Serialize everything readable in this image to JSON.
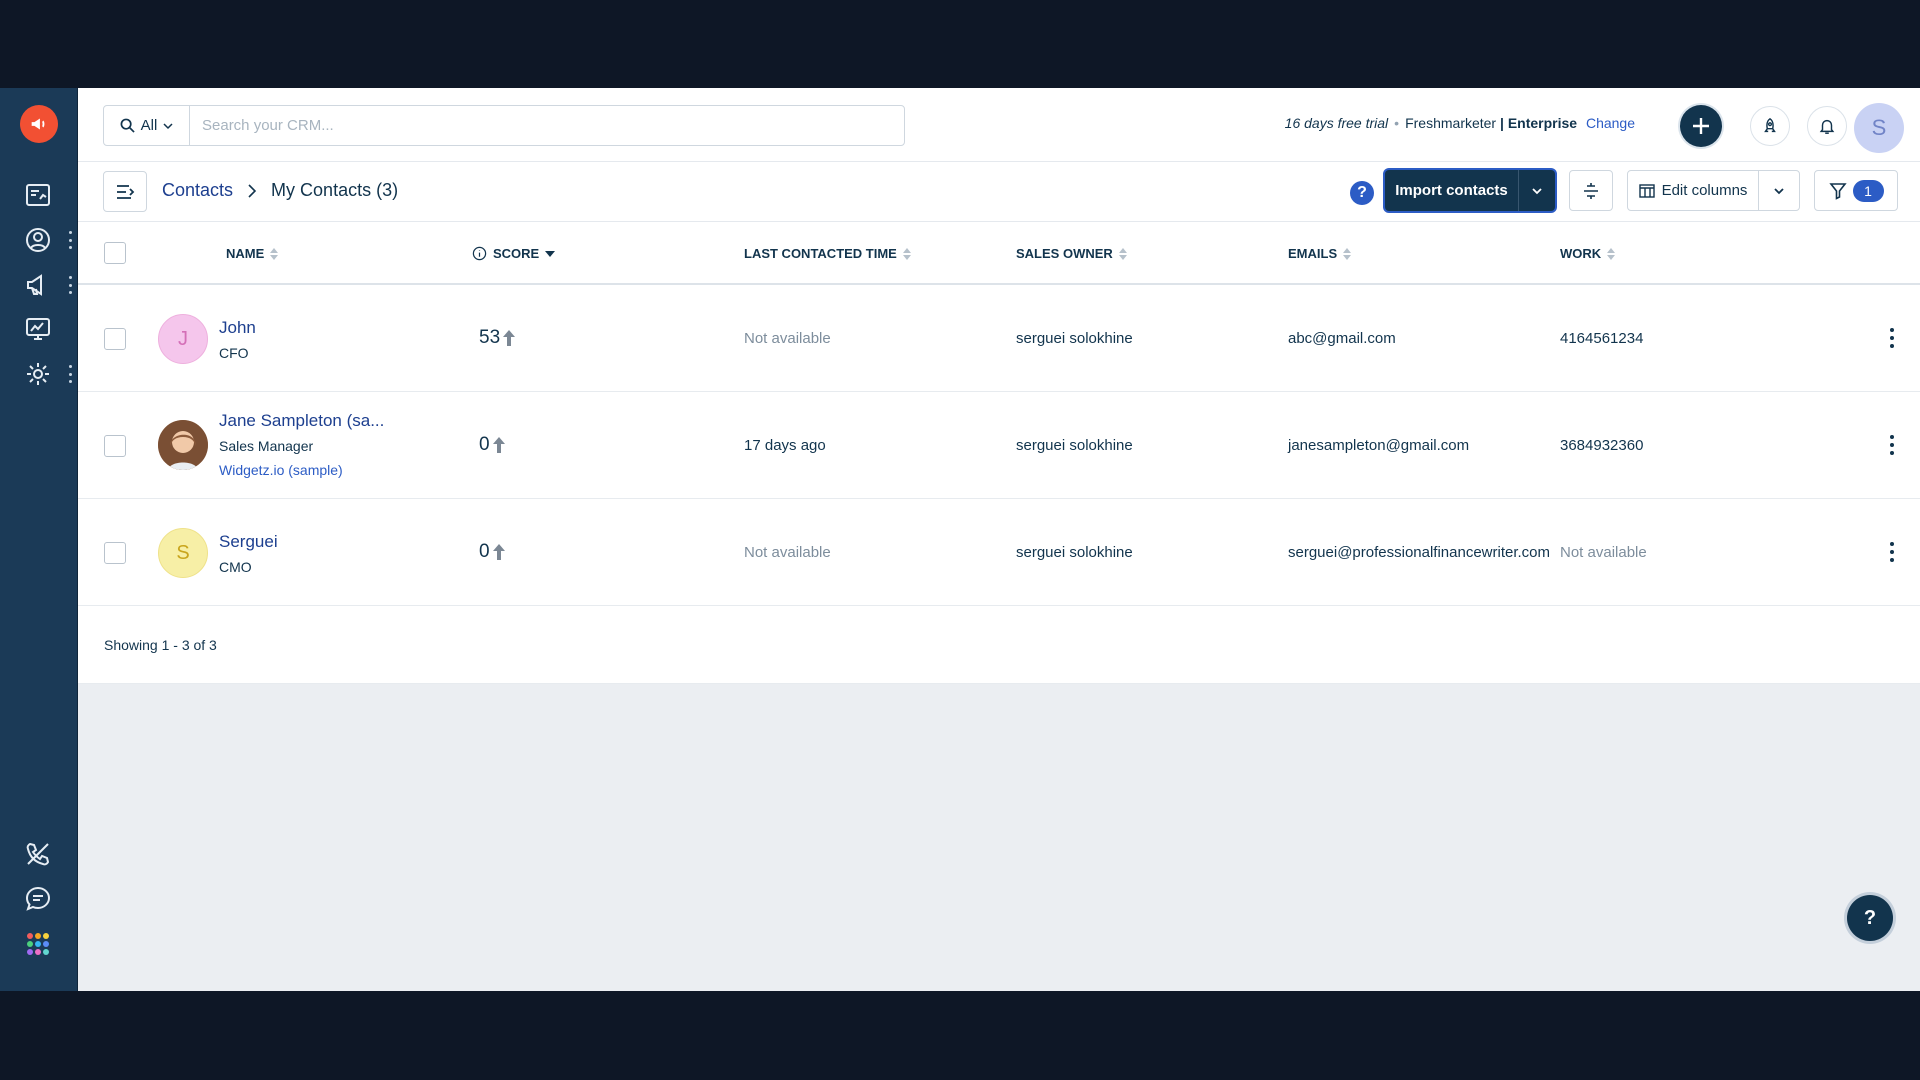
{
  "topbar": {
    "search_scope": "All",
    "search_placeholder": "Search your CRM...",
    "trial_text": "16 days free trial",
    "product": "Freshmarketer",
    "separator": "|",
    "plan": "Enterprise",
    "change_link": "Change",
    "user_initial": "S"
  },
  "subbar": {
    "crumb_root": "Contacts",
    "crumb_current": "My Contacts (3)",
    "help_symbol": "?",
    "import_label": "Import contacts",
    "edit_columns_label": "Edit columns",
    "filter_count": "1"
  },
  "table": {
    "columns": {
      "name": "NAME",
      "score": "SCORE",
      "last_contacted": "LAST CONTACTED TIME",
      "sales_owner": "SALES OWNER",
      "emails": "EMAILS",
      "work": "WORK"
    },
    "rows": [
      {
        "initial": "J",
        "name": "John",
        "title": "CFO",
        "company": "",
        "score": "53",
        "last_contacted": "Not available",
        "sales_owner": "serguei solokhine",
        "email": "abc@gmail.com",
        "work": "4164561234"
      },
      {
        "initial": "",
        "name": "Jane Sampleton (sa...",
        "title": "Sales Manager",
        "company": "Widgetz.io (sample)",
        "score": "0",
        "last_contacted": "17 days ago",
        "sales_owner": "serguei solokhine",
        "email": "janesampleton@gmail.com",
        "work": "3684932360"
      },
      {
        "initial": "S",
        "name": "Serguei",
        "title": "CMO",
        "company": "",
        "score": "0",
        "last_contacted": "Not available",
        "sales_owner": "serguei solokhine",
        "email": "serguei@professionalfinancewriter.com",
        "work": "Not available"
      }
    ],
    "showing": "Showing 1 - 3 of 3"
  },
  "help_fab": "?",
  "colors": {
    "rail": "#1b3a57",
    "primary": "#12344d",
    "accent": "#2c5cc5",
    "logo": "#f25033",
    "avatar_john": "#f5c6ec",
    "avatar_serguei": "#f7efa6"
  },
  "icons": {
    "rail_top": [
      "megaphone-logo-icon",
      "dashboard-icon",
      "contact-icon",
      "campaign-icon",
      "monitor-chart-icon",
      "settings-icon"
    ],
    "rail_bottom": [
      "phone-icon",
      "chat-icon",
      "apps-grid-icon"
    ]
  }
}
